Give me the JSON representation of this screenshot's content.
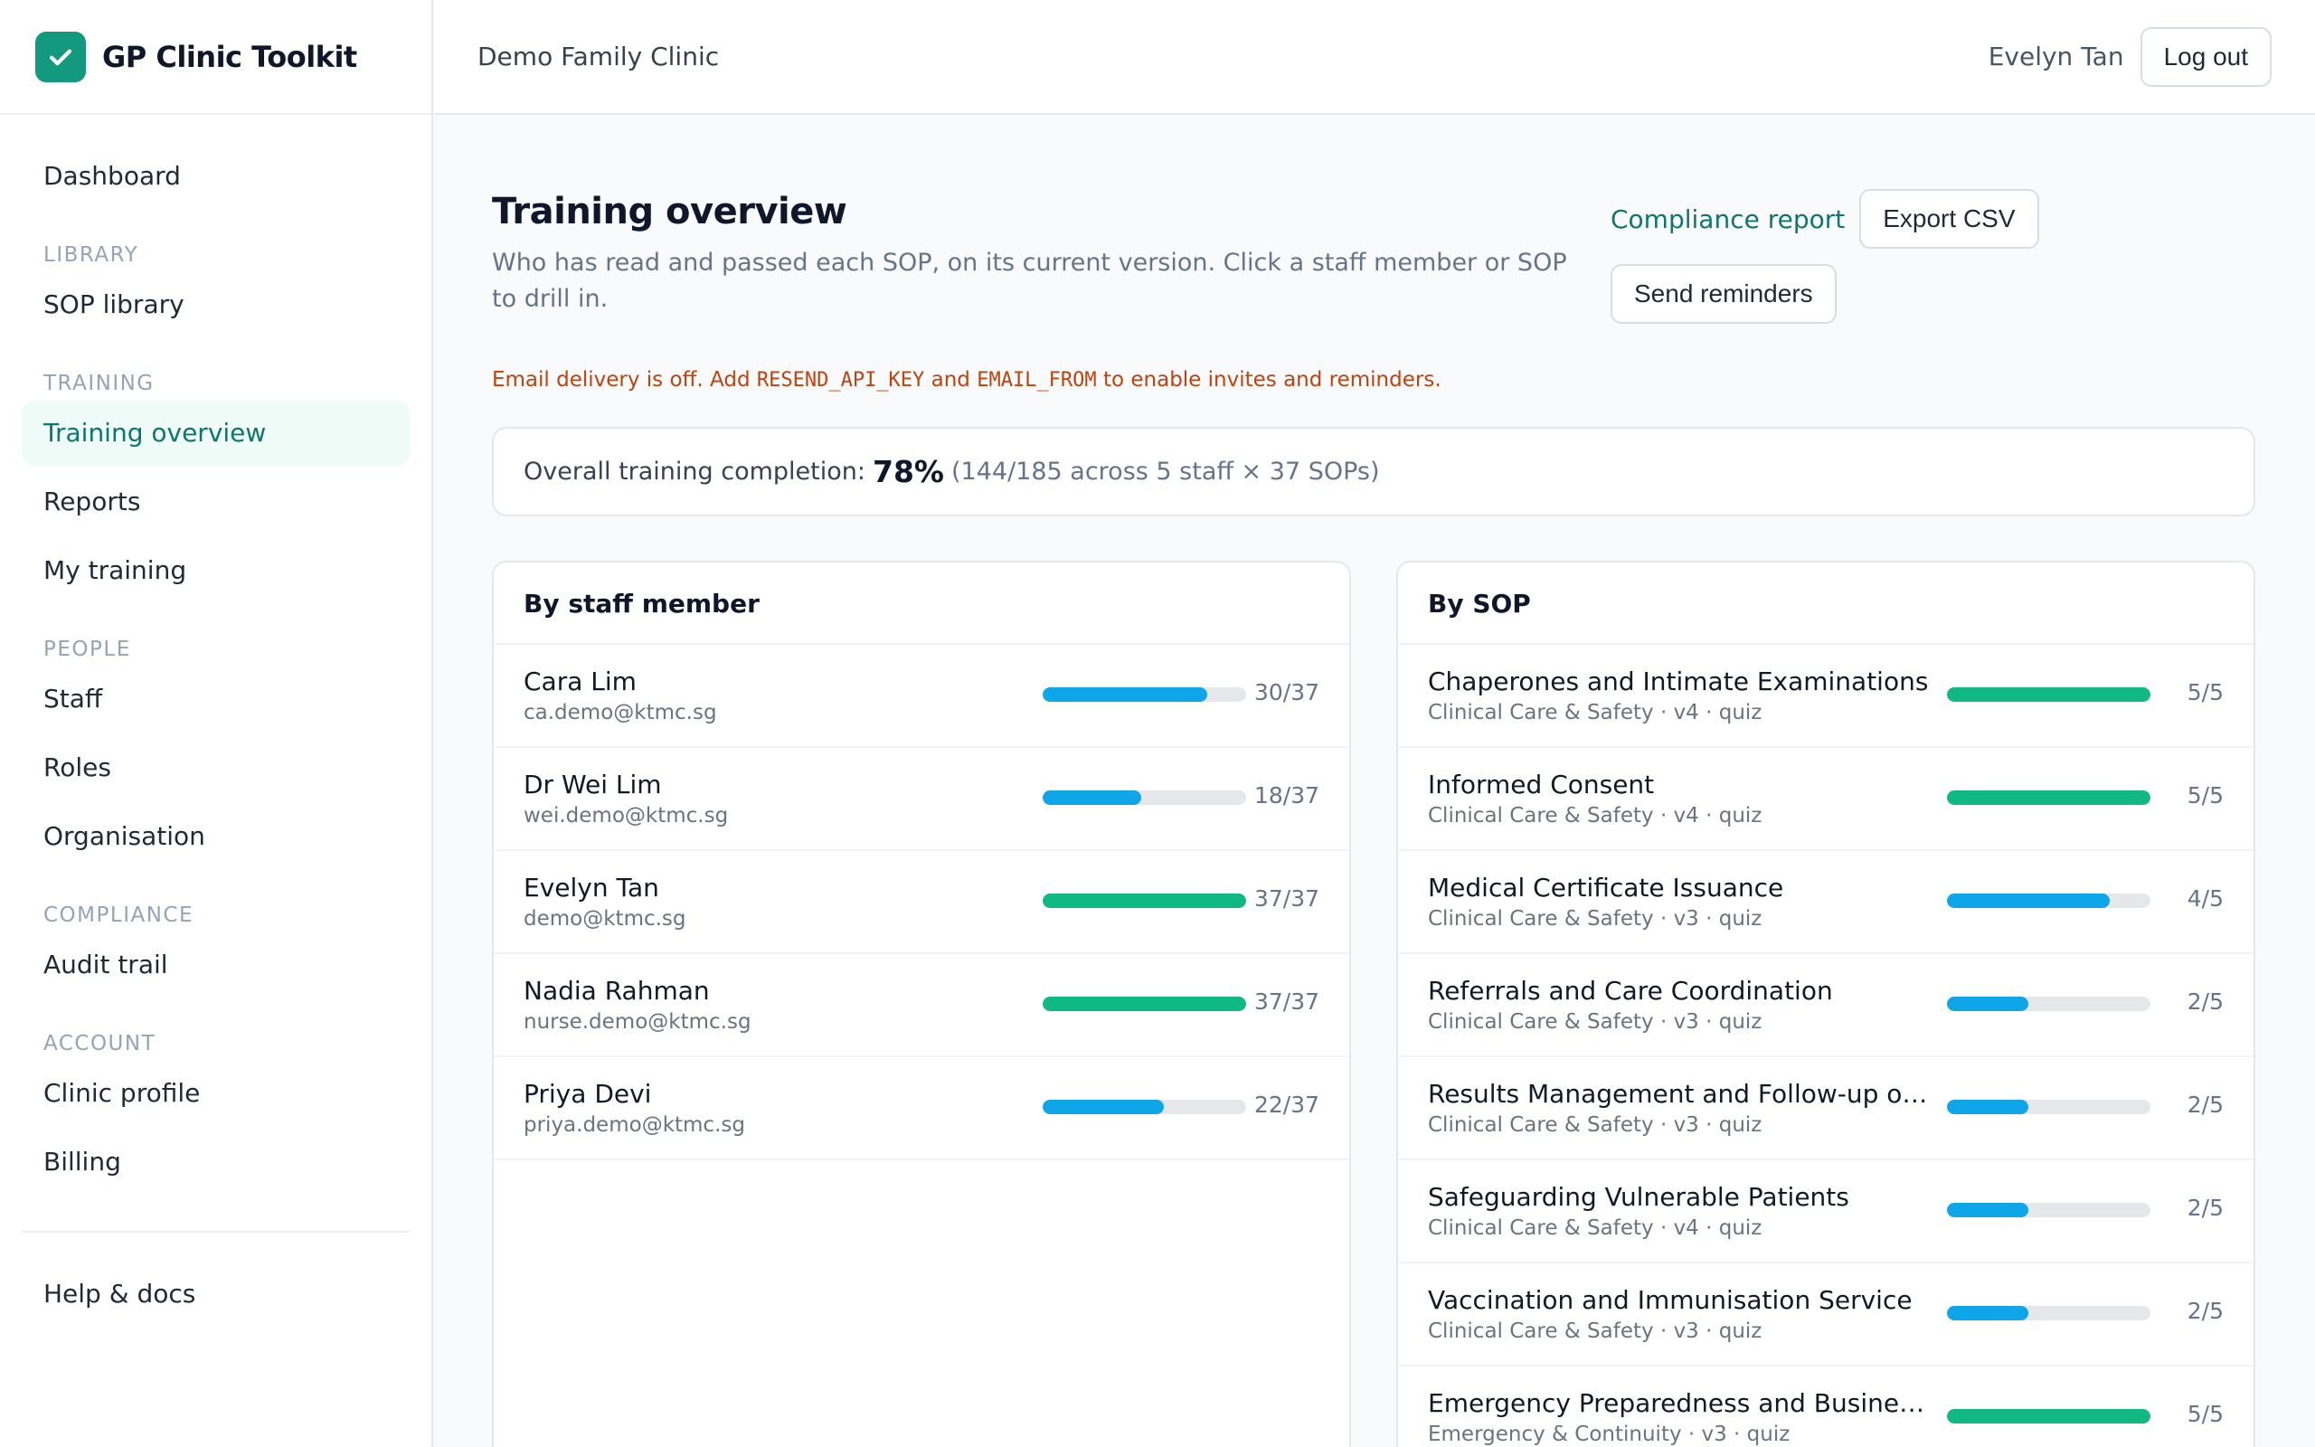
{
  "brand": {
    "name": "GP Clinic Toolkit",
    "logo_icon": "check-icon",
    "color": "#139a7e"
  },
  "nav": {
    "dashboard": "Dashboard",
    "library_header": "LIBRARY",
    "sop_library": "SOP library",
    "training_header": "TRAINING",
    "training_overview": "Training overview",
    "reports": "Reports",
    "my_training": "My training",
    "people_header": "PEOPLE",
    "staff": "Staff",
    "roles": "Roles",
    "organisation": "Organisation",
    "compliance_header": "COMPLIANCE",
    "audit_trail": "Audit trail",
    "account_header": "ACCOUNT",
    "clinic_profile": "Clinic profile",
    "billing": "Billing",
    "help": "Help & docs"
  },
  "topbar": {
    "clinic": "Demo Family Clinic",
    "user": "Evelyn Tan",
    "logout": "Log out"
  },
  "page": {
    "title": "Training overview",
    "subtitle": "Who has read and passed each SOP, on its current version. Click a staff member or SOP to drill in.",
    "compliance_report": "Compliance report",
    "export_csv": "Export CSV",
    "send_reminders": "Send reminders"
  },
  "warning": {
    "part1": "Email delivery is off. Add ",
    "key1": "RESEND_API_KEY",
    "part2": " and ",
    "key2": "EMAIL_FROM",
    "part3": " to enable invites and reminders."
  },
  "overall": {
    "label": "Overall training completion:",
    "percent": "78%",
    "detail": "(144/185 across 5 staff × 37 SOPs)"
  },
  "colors": {
    "complete": "#10b981",
    "partial": "#0ea5e9",
    "accent": "#0f766e",
    "warning": "#c2410c"
  },
  "staff_panel": {
    "title": "By staff member",
    "rows": [
      {
        "name": "Cara Lim",
        "email": "ca.demo@ktmc.sg",
        "done": 30,
        "total": 37,
        "count": "30/37"
      },
      {
        "name": "Dr Wei Lim",
        "email": "wei.demo@ktmc.sg",
        "done": 18,
        "total": 37,
        "count": "18/37"
      },
      {
        "name": "Evelyn Tan",
        "email": "demo@ktmc.sg",
        "done": 37,
        "total": 37,
        "count": "37/37"
      },
      {
        "name": "Nadia Rahman",
        "email": "nurse.demo@ktmc.sg",
        "done": 37,
        "total": 37,
        "count": "37/37"
      },
      {
        "name": "Priya Devi",
        "email": "priya.demo@ktmc.sg",
        "done": 22,
        "total": 37,
        "count": "22/37"
      }
    ]
  },
  "sop_panel": {
    "title": "By SOP",
    "rows": [
      {
        "name": "Chaperones and Intimate Examinations",
        "meta": "Clinical Care & Safety · v4 · quiz",
        "done": 5,
        "total": 5,
        "count": "5/5"
      },
      {
        "name": "Informed Consent",
        "meta": "Clinical Care & Safety · v4 · quiz",
        "done": 5,
        "total": 5,
        "count": "5/5"
      },
      {
        "name": "Medical Certificate Issuance",
        "meta": "Clinical Care & Safety · v3 · quiz",
        "done": 4,
        "total": 5,
        "count": "4/5"
      },
      {
        "name": "Referrals and Care Coordination",
        "meta": "Clinical Care & Safety · v3 · quiz",
        "done": 2,
        "total": 5,
        "count": "2/5"
      },
      {
        "name": "Results Management and Follow-up of Ab...",
        "meta": "Clinical Care & Safety · v3 · quiz",
        "done": 2,
        "total": 5,
        "count": "2/5"
      },
      {
        "name": "Safeguarding Vulnerable Patients",
        "meta": "Clinical Care & Safety · v4 · quiz",
        "done": 2,
        "total": 5,
        "count": "2/5"
      },
      {
        "name": "Vaccination and Immunisation Service",
        "meta": "Clinical Care & Safety · v3 · quiz",
        "done": 2,
        "total": 5,
        "count": "2/5"
      },
      {
        "name": "Emergency Preparedness and Business Co...",
        "meta": "Emergency & Continuity · v3 · quiz",
        "done": 5,
        "total": 5,
        "count": "5/5"
      }
    ]
  }
}
